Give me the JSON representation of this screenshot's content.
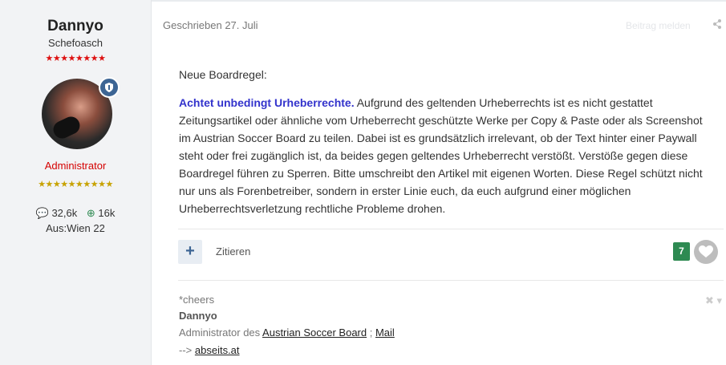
{
  "author": {
    "name": "Dannyo",
    "title": "Schefoasch",
    "rank_stars": "★★★★★★★★",
    "badge_icon": "shield-icon",
    "role": "Administrator",
    "role_stars": "★★★★★★★★★★",
    "content_count": "32,6k",
    "reputation": "16k",
    "location": "Aus:Wien 22"
  },
  "post": {
    "date": "Geschrieben 27. Juli",
    "report_label": "Beitrag melden",
    "intro": "Neue Boardregel:",
    "highlight": "Achtet unbedingt Urheberrechte.",
    "body": " Aufgrund des geltenden Urheberrechts ist es nicht gestattet Zeitungsartikel oder ähnliche vom Urheberrecht geschützte Werke per Copy & Paste oder als Screenshot im Austrian Soccer Board zu teilen. Dabei ist es grundsätzlich irrelevant, ob der Text hinter einer Paywall steht oder frei zugänglich ist, da beides gegen geltendes Urheberrecht verstößt. Verstöße gegen diese Boardregel führen zu Sperren. Bitte umschreibt den Artikel mit eigenen Worten. Diese Regel schützt nicht nur uns als Forenbetreiber, sondern in erster Linie euch, da euch aufgrund einer möglichen Urheberrechtsverletzung rechtliche Probleme drohen."
  },
  "actions": {
    "plus_label": "+",
    "quote_label": "Zitieren",
    "reaction_count": "7"
  },
  "signature": {
    "line1": "*cheers",
    "line2": "Dannyo",
    "line3_prefix": "Administrator des ",
    "line3_link1": "Austrian Soccer Board",
    "line3_sep": " ; ",
    "line3_link2": "Mail",
    "line4_prefix": "--> ",
    "line4_link": "abseits.at",
    "controls": "✖ ▾"
  },
  "colors": {
    "role": "#d50000",
    "highlight": "#3333cc",
    "reaction": "#2e8a52",
    "badge": "#3d6594"
  }
}
